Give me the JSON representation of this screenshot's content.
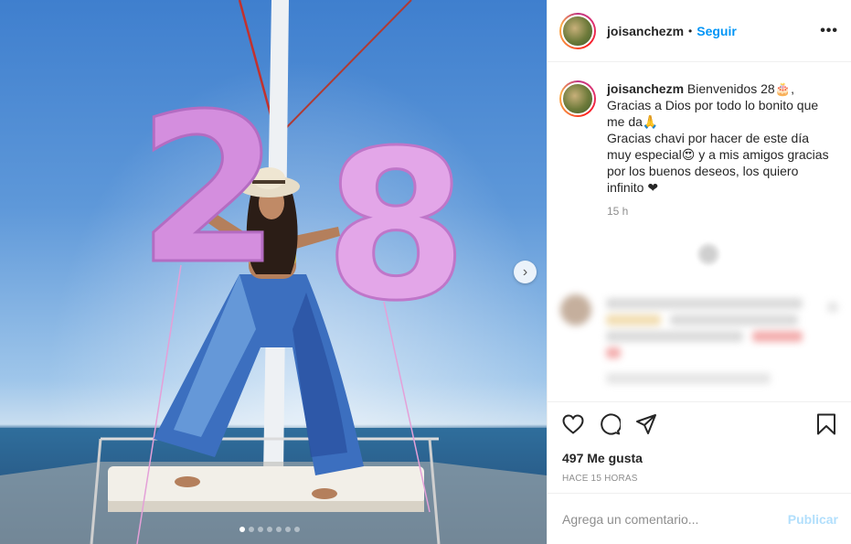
{
  "post": {
    "username": "joisanchezm",
    "separator": "•",
    "follow_label": "Seguir",
    "more_label": "•••",
    "caption_username": "joisanchezm",
    "caption_lines": [
      "Bienvenidos 28🎂,",
      "Gracias a Dios por todo lo bonito que",
      "me da🙏",
      "Gracias chavi por hacer de este día",
      "muy especial😍 y a mis amigos gracias",
      "por los buenos deseos, los quiero",
      "infinito ❤"
    ],
    "caption_time": "15 h",
    "likes": "497 Me gusta",
    "time_ago": "HACE 15 HORAS",
    "comment_placeholder": "Agrega un comentario...",
    "publish_label": "Publicar"
  },
  "media": {
    "balloon_text": [
      "2",
      "8"
    ],
    "balloon_color": "#d89be0",
    "carousel_count": 7,
    "carousel_active": 0,
    "next_arrow": "›"
  },
  "icons": {
    "like": "heart-icon",
    "comment": "speech-bubble-icon",
    "share": "paper-plane-icon",
    "save": "bookmark-icon"
  }
}
